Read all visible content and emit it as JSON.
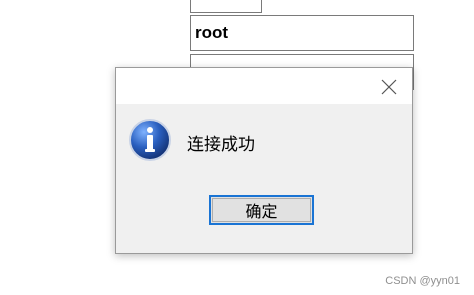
{
  "background": {
    "username_value": "root",
    "password_value": "••••"
  },
  "dialog": {
    "message": "连接成功",
    "ok_label": "确定",
    "icon": "information-icon"
  },
  "watermark": "CSDN @yyn01",
  "colors": {
    "dialog_body": "#f0f0f0",
    "titlebar": "#ffffff",
    "button_focus_border": "#1a74d4",
    "icon_blue": "#2a5fbf"
  }
}
